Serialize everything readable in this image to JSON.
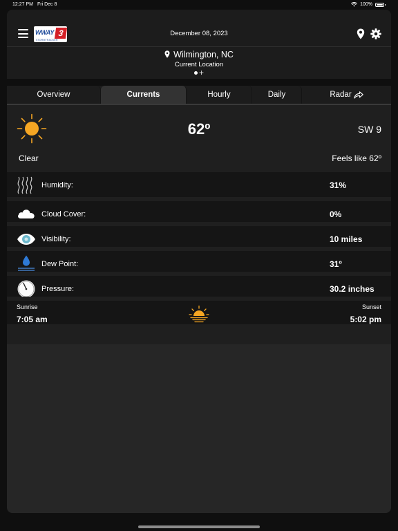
{
  "status_bar": {
    "time": "12:27 PM",
    "date": "Fri Dec 8",
    "battery": "100%"
  },
  "header": {
    "logo_text": "WWAY",
    "logo_number": "3",
    "logo_sub": "STORMTRACKER",
    "date": "December 08, 2023"
  },
  "location": {
    "city": "Wilmington, NC",
    "subtitle": "Current Location",
    "add": "+"
  },
  "tabs": [
    {
      "label": "Overview"
    },
    {
      "label": "Currents"
    },
    {
      "label": "Hourly"
    },
    {
      "label": "Daily"
    },
    {
      "label": "Radar"
    }
  ],
  "current": {
    "temperature": "62º",
    "wind": "SW 9",
    "condition": "Clear",
    "feels_like": "Feels like 62º"
  },
  "details": [
    {
      "label": "Humidity:",
      "value": "31%",
      "icon": "humidity-icon"
    },
    {
      "label": "Cloud Cover:",
      "value": "0%",
      "icon": "cloud-icon"
    },
    {
      "label": "Visibility:",
      "value": "10 miles",
      "icon": "eye-icon"
    },
    {
      "label": "Dew Point:",
      "value": "31º",
      "icon": "droplet-icon"
    },
    {
      "label": "Pressure:",
      "value": "30.2 inches",
      "icon": "gauge-icon"
    }
  ],
  "sun": {
    "sunrise_label": "Sunrise",
    "sunrise": "7:05 am",
    "sunset_label": "Sunset",
    "sunset": "5:02 pm"
  },
  "colors": {
    "accent": "#f5a623",
    "background": "#1f1f1f",
    "row": "#151515",
    "tab_active": "#333333"
  }
}
